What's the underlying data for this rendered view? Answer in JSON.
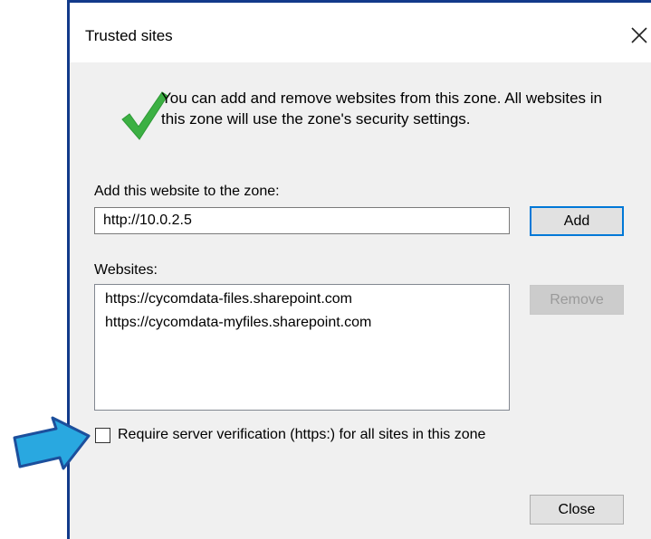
{
  "dialog": {
    "title": "Trusted sites",
    "info_line1": "You can add and remove websites from this zone. All websites in",
    "info_line2": "this zone will use the zone's security settings.",
    "add_label": "Add this website to the zone:",
    "add_value": "http://10.0.2.5",
    "add_button": "Add",
    "websites_label": "Websites:",
    "websites": [
      "https://cycomdata-files.sharepoint.com",
      "https://cycomdata-myfiles.sharepoint.com"
    ],
    "remove_button": "Remove",
    "checkbox_label": "Require server verification (https:) for all sites in this zone",
    "checkbox_checked": false,
    "close_button": "Close"
  },
  "icons": {
    "check": "checkmark-icon",
    "close": "close-icon",
    "pointer": "arrow-pointer-icon"
  },
  "colors": {
    "accent": "#0078d7",
    "check_green": "#3cb043",
    "arrow_blue": "#29a8e0",
    "frame_border": "#123a8a"
  }
}
